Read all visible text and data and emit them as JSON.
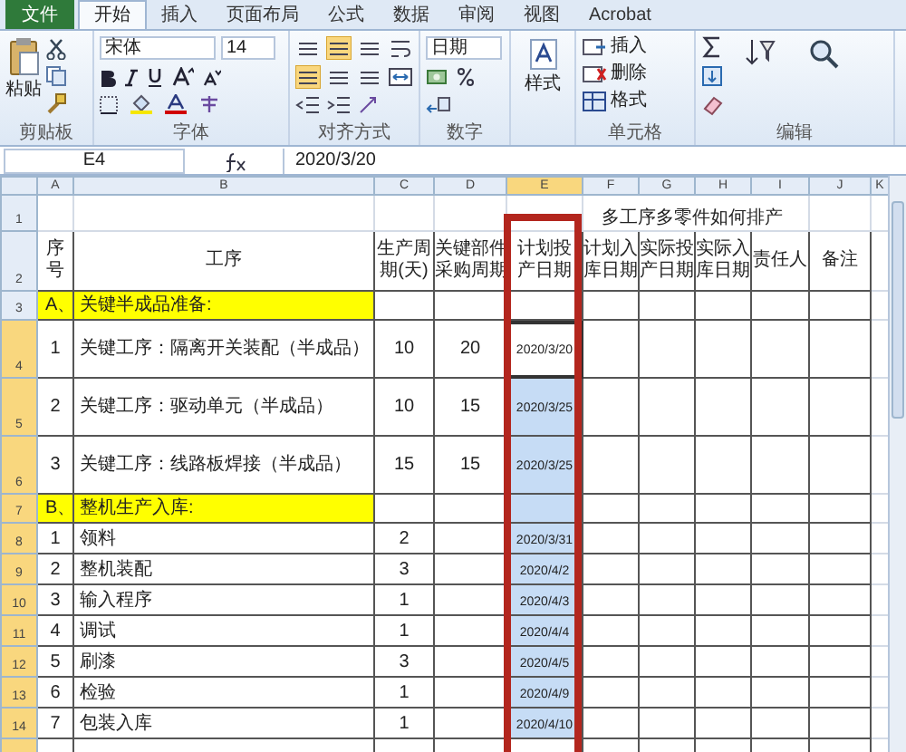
{
  "ribbon": {
    "tabs": [
      {
        "label": "文件",
        "kind": "file",
        "selected": false
      },
      {
        "label": "开始",
        "kind": "tab",
        "selected": true
      },
      {
        "label": "插入",
        "kind": "tab",
        "selected": false
      },
      {
        "label": "页面布局",
        "kind": "tab",
        "selected": false
      },
      {
        "label": "公式",
        "kind": "tab",
        "selected": false
      },
      {
        "label": "数据",
        "kind": "tab",
        "selected": false
      },
      {
        "label": "审阅",
        "kind": "tab",
        "selected": false
      },
      {
        "label": "视图",
        "kind": "tab",
        "selected": false
      },
      {
        "label": "Acrobat",
        "kind": "tab",
        "selected": false
      }
    ],
    "paste_label": "粘贴",
    "font_name": "宋体",
    "font_size": "14",
    "number_format": "日期",
    "styles_label": "样式",
    "cell_buttons": [
      "插入",
      "删除",
      "格式"
    ],
    "groups": [
      "剪贴板",
      "字体",
      "对齐方式",
      "数字",
      "单元格",
      "编辑"
    ]
  },
  "formula_bar": {
    "name_box": "E4",
    "formula": "2020/3/20"
  },
  "sheet": {
    "columns": [
      {
        "label": "A",
        "selected": false
      },
      {
        "label": "B",
        "selected": false
      },
      {
        "label": "C",
        "selected": false
      },
      {
        "label": "D",
        "selected": false
      },
      {
        "label": "E",
        "selected": true
      },
      {
        "label": "F",
        "selected": false
      },
      {
        "label": "G",
        "selected": false
      },
      {
        "label": "H",
        "selected": false
      },
      {
        "label": "I",
        "selected": false
      },
      {
        "label": "J",
        "selected": false
      },
      {
        "label": "K",
        "selected": false
      }
    ],
    "title_row": {
      "number": "1",
      "title": "多工序多零件如何排产"
    },
    "header_row_number": "2",
    "header": [
      "序号",
      "工序",
      "生产周期(天)",
      "关键部件采购周期",
      "计划投产日期",
      "计划入库日期",
      "实际投产日期",
      "实际入库日期",
      "责任人",
      "备注"
    ],
    "rows": [
      {
        "number": "3",
        "kind": "section",
        "selected": false,
        "active": false,
        "cells": [
          "A、",
          "关键半成品准备:"
        ]
      },
      {
        "number": "4",
        "kind": "key_item",
        "selected": true,
        "active": true,
        "cells": [
          "1",
          "关键工序：隔离开关装配（半成品）",
          "10",
          "20",
          "2020/3/20"
        ]
      },
      {
        "number": "5",
        "kind": "key_item",
        "selected": true,
        "active": false,
        "cells": [
          "2",
          "关键工序：驱动单元（半成品）",
          "10",
          "15",
          "2020/3/25"
        ]
      },
      {
        "number": "6",
        "kind": "key_item",
        "selected": true,
        "active": false,
        "cells": [
          "3",
          "关键工序：线路板焊接（半成品）",
          "15",
          "15",
          "2020/3/25"
        ]
      },
      {
        "number": "7",
        "kind": "section",
        "selected": true,
        "active": false,
        "cells": [
          "B、",
          "整机生产入库:"
        ]
      },
      {
        "number": "8",
        "kind": "step",
        "selected": true,
        "active": false,
        "cells": [
          "1",
          "领料",
          "2",
          "",
          "2020/3/31"
        ]
      },
      {
        "number": "9",
        "kind": "step",
        "selected": true,
        "active": false,
        "cells": [
          "2",
          "整机装配",
          "3",
          "",
          "2020/4/2"
        ]
      },
      {
        "number": "10",
        "kind": "step",
        "selected": true,
        "active": false,
        "cells": [
          "3",
          "输入程序",
          "1",
          "",
          "2020/4/3"
        ]
      },
      {
        "number": "11",
        "kind": "step",
        "selected": true,
        "active": false,
        "cells": [
          "4",
          "调试",
          "1",
          "",
          "2020/4/4"
        ]
      },
      {
        "number": "12",
        "kind": "step",
        "selected": true,
        "active": false,
        "cells": [
          "5",
          "刷漆",
          "3",
          "",
          "2020/4/5"
        ]
      },
      {
        "number": "13",
        "kind": "step",
        "selected": true,
        "active": false,
        "cells": [
          "6",
          "检验",
          "1",
          "",
          "2020/4/9"
        ]
      },
      {
        "number": "14",
        "kind": "step",
        "selected": true,
        "active": false,
        "cells": [
          "7",
          "包装入库",
          "1",
          "",
          "2020/4/10"
        ]
      }
    ]
  }
}
